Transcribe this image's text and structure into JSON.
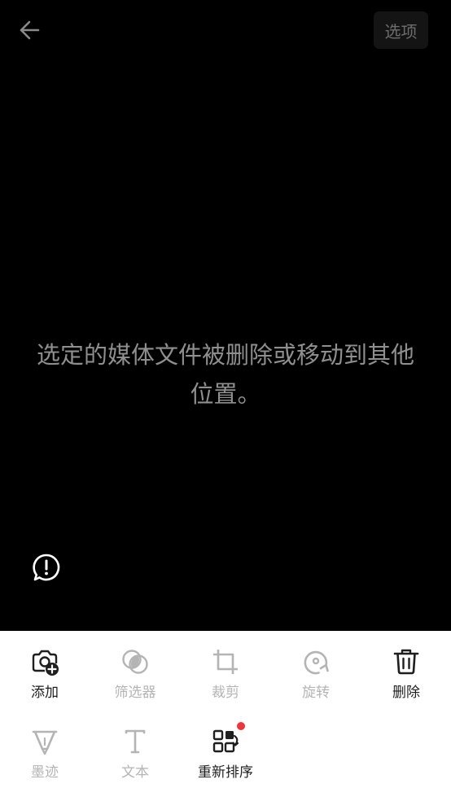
{
  "header": {
    "back_icon": "arrow-left-icon",
    "options_label": "选项"
  },
  "viewer": {
    "message": "选定的媒体文件被删除或移动到其他位置。",
    "feedback_icon": "exclamation-bubble-icon"
  },
  "toolbar": {
    "colors": {
      "enabled": "#1f1f1f",
      "disabled": "#b4b4b4",
      "badge": "#f0343c"
    },
    "tools": [
      {
        "id": "add",
        "label": "添加",
        "icon": "camera-add-icon",
        "enabled": true
      },
      {
        "id": "filter",
        "label": "筛选器",
        "icon": "filter-circles-icon",
        "enabled": false
      },
      {
        "id": "crop",
        "label": "裁剪",
        "icon": "crop-icon",
        "enabled": false
      },
      {
        "id": "rotate",
        "label": "旋转",
        "icon": "rotate-icon",
        "enabled": false
      },
      {
        "id": "delete",
        "label": "删除",
        "icon": "trash-icon",
        "enabled": true
      },
      {
        "id": "ink",
        "label": "墨迹",
        "icon": "pen-nib-icon",
        "enabled": false
      },
      {
        "id": "text",
        "label": "文本",
        "icon": "text-t-icon",
        "enabled": false
      },
      {
        "id": "reorder",
        "label": "重新排序",
        "icon": "reorder-grid-icon",
        "enabled": true,
        "badge": true
      }
    ]
  }
}
